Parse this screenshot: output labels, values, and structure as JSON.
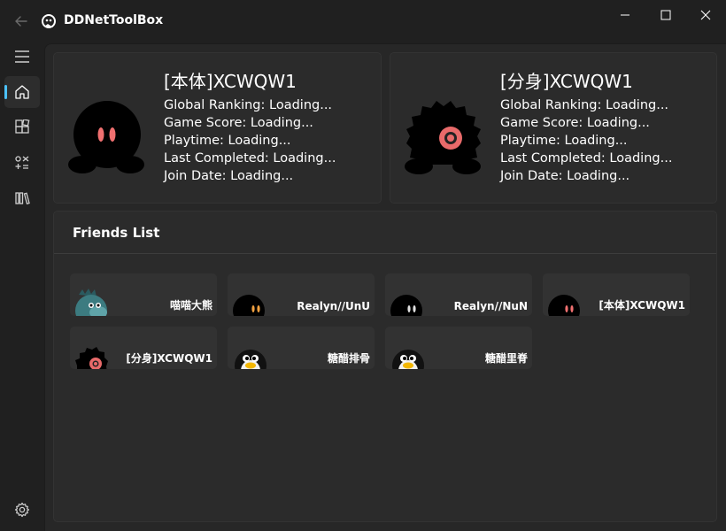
{
  "window": {
    "title": "DDNetToolBox"
  },
  "colors": {
    "accent": "#4cc2ff",
    "background": "#202020",
    "card": "#2b2b2b",
    "tile": "#323232"
  },
  "nav": {
    "items": [
      {
        "icon": "hamburger-menu-icon"
      },
      {
        "icon": "home-icon",
        "selected": true
      },
      {
        "icon": "apps-icon"
      },
      {
        "icon": "tools-icon"
      },
      {
        "icon": "library-icon"
      },
      {
        "icon": "settings-icon"
      }
    ]
  },
  "players": [
    {
      "name": "[本体]XCWQW1",
      "avatar": "black-tee-red-eyes",
      "ranking": "Global Ranking: Loading...",
      "score": "Game Score: Loading...",
      "playtime": "Playtime: Loading...",
      "last_completed": "Last Completed: Loading...",
      "join_date": "Join Date: Loading..."
    },
    {
      "name": "[分身]XCWQW1",
      "avatar": "black-fuzzy-tee-single-eye",
      "ranking": "Global Ranking: Loading...",
      "score": "Game Score: Loading...",
      "playtime": "Playtime: Loading...",
      "last_completed": "Last Completed: Loading...",
      "join_date": "Join Date: Loading..."
    }
  ],
  "friends": {
    "title": "Friends List",
    "items": [
      {
        "name": "喵喵大熊",
        "avatar": "teal-dino-tee"
      },
      {
        "name": "Realyn//UnU",
        "avatar": "black-tee-orange-eyes"
      },
      {
        "name": "Realyn//NuN",
        "avatar": "black-tee-white-eyes"
      },
      {
        "name": "[本体]XCWQW1",
        "avatar": "black-tee-red-eyes"
      },
      {
        "name": "[分身]XCWQW1",
        "avatar": "black-fuzzy-tee-single-eye"
      },
      {
        "name": "糖醋排骨",
        "avatar": "penguin-tee"
      },
      {
        "name": "糖醋里脊",
        "avatar": "penguin-tee"
      }
    ]
  }
}
